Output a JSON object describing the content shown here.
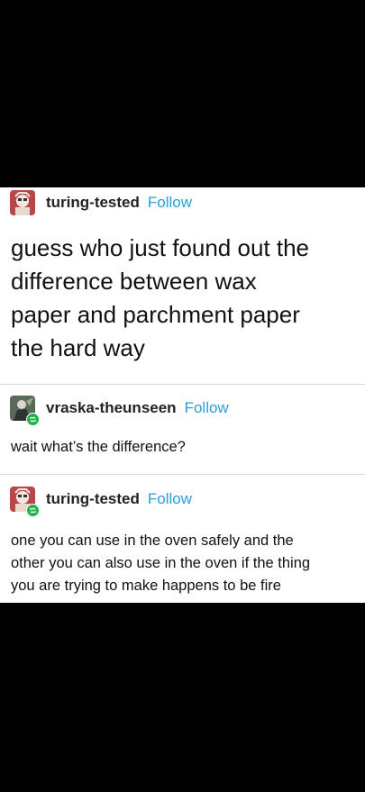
{
  "posts": [
    {
      "username": "turing-tested",
      "follow_label": "Follow",
      "avatar_icon": "avatar-icon",
      "lines": [
        "guess who just found out the",
        "difference between wax",
        "paper and parchment paper",
        "the hard way"
      ]
    },
    {
      "username": "vraska-theunseen",
      "follow_label": "Follow",
      "avatar_icon": "avatar-icon",
      "reblog_icon": "reblog-icon",
      "lines": [
        "wait what’s the difference?"
      ]
    },
    {
      "username": "turing-tested",
      "follow_label": "Follow",
      "avatar_icon": "avatar-icon",
      "reblog_icon": "reblog-icon",
      "lines": [
        "one you can use in the oven safely and the",
        "other you can also use in the oven if the thing",
        "you are trying to make happens to be fire"
      ]
    }
  ],
  "colors": {
    "follow": "#2b9fd6",
    "reblog_badge": "#22b24c",
    "background": "#000000",
    "card": "#ffffff"
  }
}
